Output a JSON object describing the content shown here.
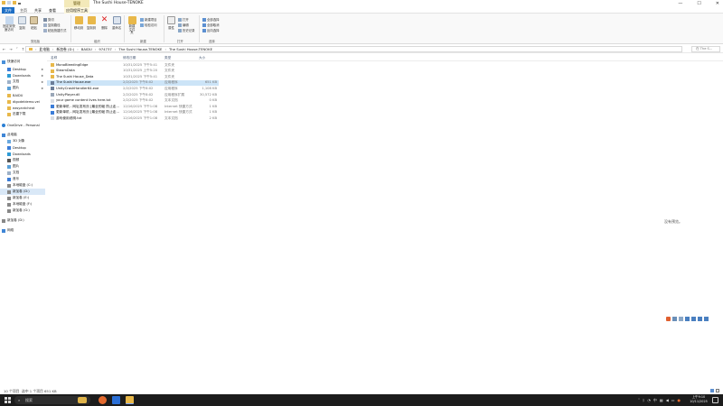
{
  "window": {
    "title": "The Sushi House-TENOKE",
    "manage_tab": "管理",
    "controls": {
      "minimize": "—",
      "maximize": "☐",
      "close": "✕"
    }
  },
  "ribbon_tabs": [
    {
      "label": "文件"
    },
    {
      "label": "主页"
    },
    {
      "label": "共享"
    },
    {
      "label": "查看"
    },
    {
      "label": "应用程序工具"
    }
  ],
  "ribbon": {
    "pin_quick": "固定到快速访问",
    "copy": "复制",
    "paste": "粘贴",
    "cut": "剪切",
    "copy_path": "复制路径",
    "paste_shortcut": "粘贴快捷方式",
    "move_to": "移动到",
    "copy_to": "复制到",
    "delete": "删除",
    "rename": "重命名",
    "new_item": "新建项目",
    "easy_access": "轻松访问",
    "new_folder": "新建文件夹",
    "properties": "属性",
    "open": "打开",
    "edit": "编辑",
    "history": "历史记录",
    "select_all": "全部选择",
    "select_none": "全部取消",
    "invert_select": "反向选择",
    "groups": [
      "剪贴板",
      "组织",
      "新建",
      "打开",
      "选择"
    ]
  },
  "address": {
    "crumbs": [
      "此电脑",
      "新加卷 (D:)",
      "BAIDU",
      "974737",
      "The Sushi House-TENOKE",
      "The Sushi House-TENOKE"
    ],
    "search_placeholder": "在 The S..."
  },
  "nav": {
    "quick_access": "快速访问",
    "items": [
      {
        "label": "Desktop",
        "pinned": true
      },
      {
        "label": "Downloads",
        "pinned": true
      },
      {
        "label": "文档",
        "pinned": true
      },
      {
        "label": "图片",
        "pinned": true
      },
      {
        "label": "BAIDU"
      },
      {
        "label": "dlgodeldemo.vei"
      },
      {
        "label": "easyantcheat"
      },
      {
        "label": "迅雷下载"
      }
    ],
    "onedrive": "OneDrive - Personal",
    "this_pc": "此电脑",
    "pc_items": [
      {
        "label": "3D 对象"
      },
      {
        "label": "Desktop"
      },
      {
        "label": "Downloads"
      },
      {
        "label": "视频"
      },
      {
        "label": "图片"
      },
      {
        "label": "文档"
      },
      {
        "label": "音乐"
      },
      {
        "label": "本地磁盘 (C:)"
      },
      {
        "label": "新加卷 (D:)",
        "selected": true
      },
      {
        "label": "新加卷 (E:)"
      },
      {
        "label": "本地磁盘 (F:)"
      },
      {
        "label": "新加卷 (G:)"
      }
    ],
    "drive_d": "新加卷 (D:)",
    "network": "网络"
  },
  "columns": {
    "name": "名称",
    "date": "修改日期",
    "type": "类型",
    "size": "大小"
  },
  "files": [
    {
      "name": "MonoBleedingEdge",
      "date": "10/31/2025 下午5:41",
      "type": "文件夹",
      "size": "",
      "kind": "folder"
    },
    {
      "name": "SteamData",
      "date": "10/31/2025 上午5:20",
      "type": "文件夹",
      "size": "",
      "kind": "folder"
    },
    {
      "name": "The Sushi House_Data",
      "date": "10/31/2025 下午5:41",
      "type": "文件夹",
      "size": "",
      "kind": "folder"
    },
    {
      "name": "The Sushi House.exe",
      "date": "2/2/2025 下午8:02",
      "type": "应用程序",
      "size": "651 KB",
      "kind": "exe",
      "selected": true
    },
    {
      "name": "UnityCrashHandler64.exe",
      "date": "2/2/2025 下午8:02",
      "type": "应用程序",
      "size": "1,108 KB",
      "kind": "exe"
    },
    {
      "name": "UnityPlayer.dll",
      "date": "2/2/2025 下午8:02",
      "type": "应用程序扩展",
      "size": "30,572 KB",
      "kind": "dll"
    },
    {
      "name": "your game content lives here.txt",
      "date": "2/2/2025 下午8:02",
      "type": "文本文档",
      "size": "0 KB",
      "kind": "txt"
    },
    {
      "name": "更新单机 - 网址发布页 [最全的破 防止走...",
      "date": "12/16/2025 下午1:08",
      "type": "Internet 快捷方式",
      "size": "1 KB",
      "kind": "url"
    },
    {
      "name": "更新单机 - 网址发布页 [最全的破 防止走...",
      "date": "12/16/2025 下午1:08",
      "type": "Internet 快捷方式",
      "size": "1 KB",
      "kind": "url"
    },
    {
      "name": "游戏使用说明.txt",
      "date": "12/16/2025 下午1:08",
      "type": "文本文档",
      "size": "2 KB",
      "kind": "txt"
    }
  ],
  "preview_text": "没有预览。",
  "status": {
    "count": "10 个项目",
    "selection": "选中 1 个项目  651 KB"
  },
  "taskbar": {
    "search": "搜索",
    "clock_time": "上午9:10",
    "clock_date": "10/11/2025"
  },
  "colors": {
    "accent": "#1f6fc5",
    "selected_row": "#cce4f7",
    "taskbar": "#1c1c1c",
    "folder": "#e8b84a"
  }
}
